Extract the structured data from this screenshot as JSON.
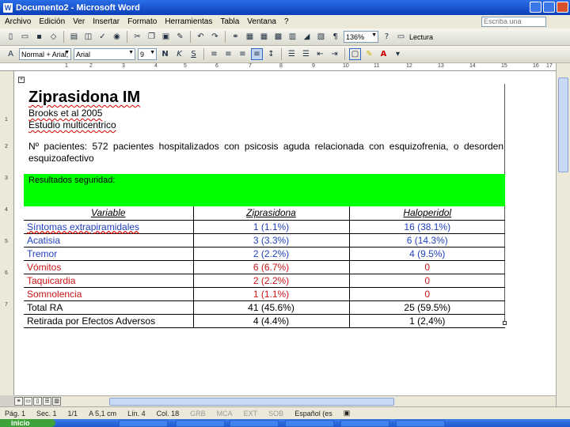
{
  "window": {
    "title": "Documento2 - Microsoft Word"
  },
  "menu": {
    "items": [
      "Archivo",
      "Edición",
      "Ver",
      "Insertar",
      "Formato",
      "Herramientas",
      "Tabla",
      "Ventana",
      "?"
    ],
    "help_placeholder": "Escriba una pregunta"
  },
  "toolbar": {
    "zoom": "136%",
    "read_label": "Lectura"
  },
  "format_bar": {
    "style": "Normal + Arial,",
    "font": "Arial",
    "size": "9"
  },
  "ruler_ticks": [
    "1",
    "2",
    "3",
    "4",
    "5",
    "6",
    "7",
    "8",
    "9",
    "10",
    "11",
    "12",
    "13",
    "14",
    "15",
    "16",
    "17"
  ],
  "document": {
    "title": "Ziprasidona IM",
    "authors": "Brooks et al 2005",
    "study_type": "Estudio multicentrico",
    "patients": "Nº pacientes: 572 pacientes hospitalizados con psicosis aguda relacionada con esquizofrenia, o desorden esquizoafectivo",
    "results_label": "Resultados seguridad:",
    "table": {
      "headers": [
        "Variable",
        "Ziprasidona",
        "Haloperidol"
      ],
      "rows": [
        {
          "variable": "Síntomas extrapiramidales",
          "zip": "1 (1.1%)",
          "hal": "16 (38.1%)",
          "vcolor": "blue",
          "zcolor": "blue",
          "hcolor": "blue"
        },
        {
          "variable": "Acatisia",
          "zip": "3 (3.3%)",
          "hal": "6 (14.3%)",
          "vcolor": "blue",
          "zcolor": "blue",
          "hcolor": "blue"
        },
        {
          "variable": "Tremor",
          "zip": "2 (2.2%)",
          "hal": "4 (9.5%)",
          "vcolor": "blue",
          "zcolor": "blue",
          "hcolor": "blue"
        },
        {
          "variable": "Vómitos",
          "zip": "6 (6.7%)",
          "hal": "0",
          "vcolor": "red",
          "zcolor": "red",
          "hcolor": "red"
        },
        {
          "variable": "Taquicardia",
          "zip": "2 (2.2%)",
          "hal": "0",
          "vcolor": "red",
          "zcolor": "red",
          "hcolor": "red"
        },
        {
          "variable": "Somnolencia",
          "zip": "1 (1.1%)",
          "hal": "0",
          "vcolor": "red",
          "zcolor": "red",
          "hcolor": "red"
        },
        {
          "variable": "Total RA",
          "zip": "41 (45.6%)",
          "hal": "25 (59.5%)",
          "vcolor": "black",
          "zcolor": "black",
          "hcolor": "black"
        },
        {
          "variable": "Retirada por Efectos Adversos",
          "zip": "4 (4.4%)",
          "hal": "1 (2,4%)",
          "vcolor": "black",
          "zcolor": "black",
          "hcolor": "black"
        }
      ]
    }
  },
  "status": {
    "page": "Pág. 1",
    "section": "Sec. 1",
    "pages": "1/1",
    "position": "A 5,1 cm",
    "line": "Lín. 4",
    "column": "Col. 18",
    "rec": "GRB",
    "mca": "MCA",
    "ext": "EXT",
    "sob": "SOB",
    "language": "Español (es"
  },
  "taskbar": {
    "start": "inicio"
  }
}
